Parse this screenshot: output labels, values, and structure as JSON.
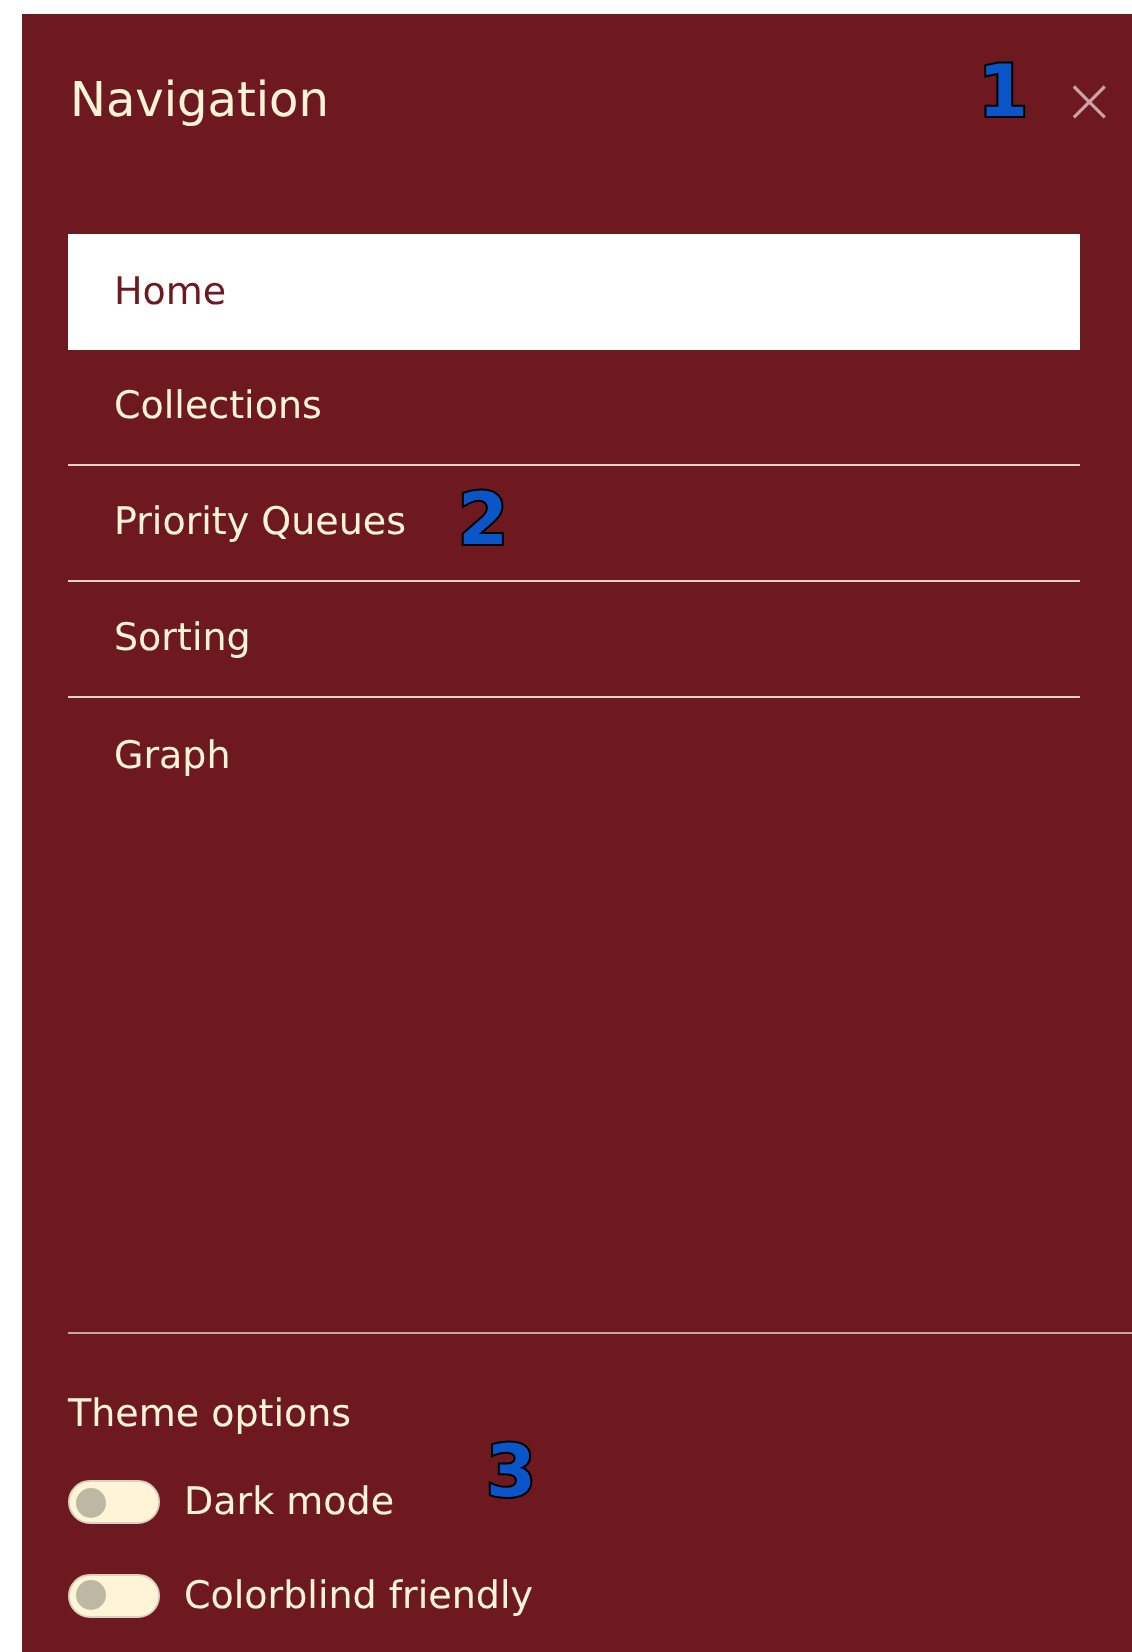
{
  "panel": {
    "title": "Navigation",
    "close": "×"
  },
  "nav_items": [
    {
      "label": "Home",
      "selected": true
    },
    {
      "label": "Collections",
      "selected": false
    },
    {
      "label": "Priority Queues",
      "selected": false
    },
    {
      "label": "Sorting",
      "selected": false
    },
    {
      "label": "Graph",
      "selected": false
    }
  ],
  "theme_options": {
    "heading": "Theme options",
    "toggles": [
      {
        "label": "Dark mode",
        "on": false
      },
      {
        "label": "Colorblind friendly",
        "on": false
      }
    ]
  },
  "callouts": [
    "1",
    "2",
    "3"
  ]
}
